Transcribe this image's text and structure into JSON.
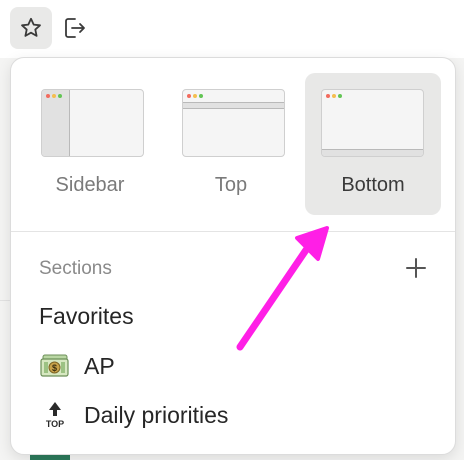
{
  "toolbar": {
    "star_icon": "star-outline-icon",
    "exit_icon": "log-out-icon"
  },
  "layout_options": [
    {
      "label": "Sidebar",
      "selected": false
    },
    {
      "label": "Top",
      "selected": false
    },
    {
      "label": "Bottom",
      "selected": true
    }
  ],
  "sections": {
    "label": "Sections",
    "add_icon": "plus-icon",
    "items": [
      {
        "label": "Favorites",
        "icon": null
      },
      {
        "label": "AP",
        "icon": "dollar-banknote-emoji"
      },
      {
        "label": "Daily priorities",
        "icon": "top-arrow-emoji",
        "icon_text": "TOP"
      }
    ]
  },
  "annotation": {
    "type": "arrow",
    "color": "#ff1fe6",
    "points_to": "Bottom"
  },
  "colors": {
    "selected_bg": "#e8e8e7",
    "accent_arrow": "#ff1fe6"
  }
}
